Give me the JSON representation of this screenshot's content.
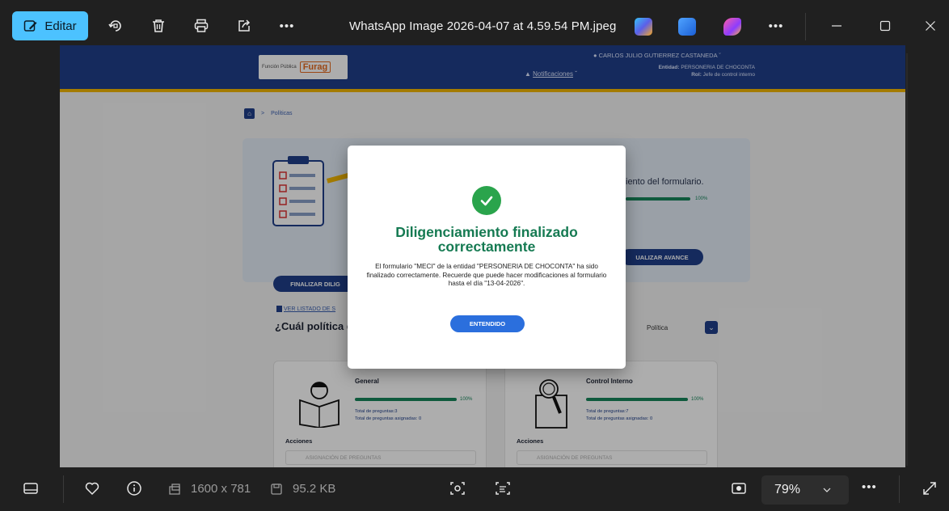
{
  "toolbar": {
    "edit_label": "Editar",
    "file_title": "WhatsApp Image 2026-04-07 at 4.59.54 PM.jpeg",
    "more_label": "•••"
  },
  "photo": {
    "header": {
      "logo_left": "Función Pública",
      "logo_right": "Furag",
      "user": "CARLOS JULIO GUTIERREZ CASTANEDA",
      "entidad_label": "Entidad:",
      "entidad_value": "PERSONERIA DE CHOCONTA",
      "rol_label": "Rol:",
      "rol_value": "Jefe de control interno",
      "notifications": "Notificaciones"
    },
    "breadcrumb": "Políticas",
    "progress_text": "iento del formulario.",
    "progress_pct": "100%",
    "btn_finalize": "FINALIZAR DILIG",
    "btn_update": "UALIZAR AVANCE",
    "link_list": "VER LISTADO DE S",
    "question": "¿Cuál política d",
    "select_value": "Política",
    "cards": [
      {
        "title": "General",
        "pct": "100%",
        "total": "Total de preguntas:3",
        "assigned": "Total de preguntas asignadas: 0",
        "actions": "Acciones",
        "assign": "ASIGNACIÓN DE PREGUNTAS"
      },
      {
        "title": "Control Interno",
        "pct": "100%",
        "total": "Total de preguntas:7",
        "assigned": "Total de preguntas asignadas: 0",
        "actions": "Acciones",
        "assign": "ASIGNACIÓN DE PREGUNTAS"
      }
    ]
  },
  "modal": {
    "title": "Diligenciamiento finalizado correctamente",
    "body": "El formulario \"MECI\" de la entidad \"PERSONERIA DE CHOCONTA\" ha sido finalizado correctamente. Recuerde que puede hacer modificaciones al formulario hasta el día \"13-04-2026\".",
    "button": "ENTENDIDO"
  },
  "bottombar": {
    "dimensions": "1600 x 781",
    "filesize": "95.2 KB",
    "zoom": "79%"
  },
  "colors": {
    "accent": "#4cc2ff",
    "header_blue": "#1f3f8a",
    "success_green": "#157a52",
    "button_blue": "#2b6fdd"
  }
}
